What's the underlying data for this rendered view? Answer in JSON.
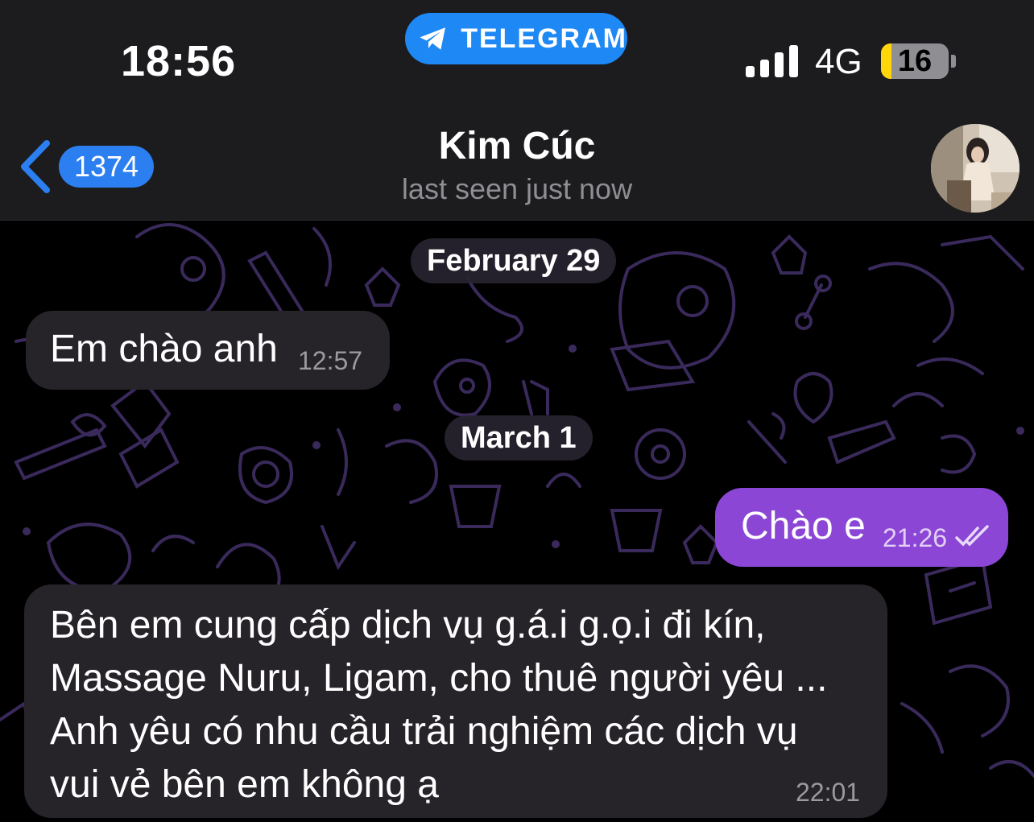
{
  "status_bar": {
    "time": "18:56",
    "app_pill": "TELEGRAM",
    "network": "4G",
    "battery_level": "16",
    "battery_fraction": 0.16
  },
  "header": {
    "back_badge": "1374",
    "contact_name": "Kim Cúc",
    "status": "last seen just now"
  },
  "chat": {
    "date_1": "February 29",
    "msg_1": {
      "text": "Em chào anh",
      "time": "12:57"
    },
    "date_2": "March 1",
    "msg_2": {
      "text": "Chào e",
      "time": "21:26",
      "read": true
    },
    "msg_3": {
      "lines": [
        "Bên em cung cấp dịch vụ g.á.i g.ọ.i đi kín,",
        "Massage Nuru, Ligam, cho thuê người yêu ...",
        "Anh yêu có nhu cầu trải nghiệm các dịch vụ",
        "vui vẻ bên em không ạ"
      ],
      "time": "22:01"
    }
  },
  "colors": {
    "accent": "#1e88f5",
    "outgoing_bubble": "#8b46d6",
    "incoming_bubble": "#262329",
    "wallpaper_doodle": "#3a2a5c"
  }
}
